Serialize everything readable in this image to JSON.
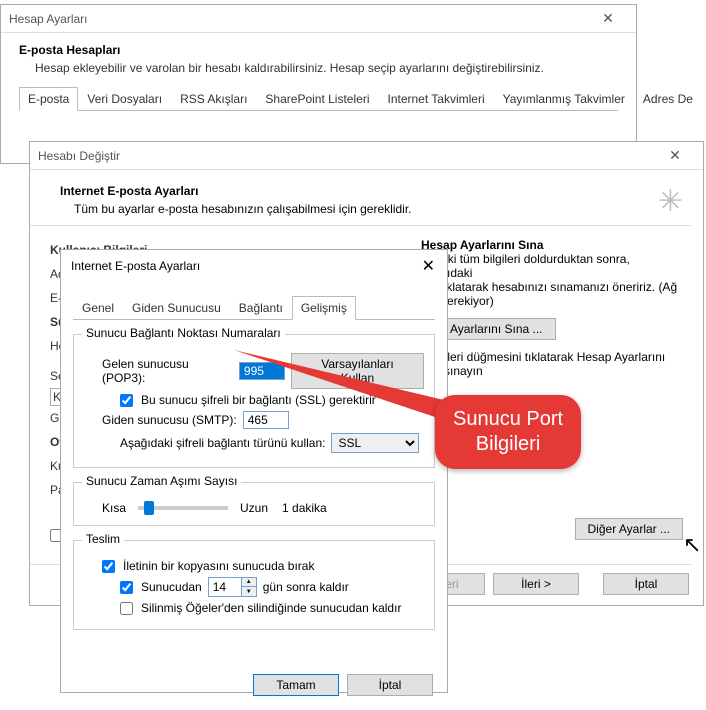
{
  "win1": {
    "title": "Hesap Ayarları",
    "heading": "E-posta Hesapları",
    "desc": "Hesap ekleyebilir ve varolan bir hesabı kaldırabilirsiniz. Hesap seçip ayarlarını değiştirebilirsiniz.",
    "tabs": [
      "E-posta",
      "Veri Dosyaları",
      "RSS Akışları",
      "SharePoint Listeleri",
      "Internet Takvimleri",
      "Yayımlanmış Takvimler",
      "Adres De"
    ]
  },
  "win2": {
    "title": "Hesabı Değiştir",
    "heading": "Internet E-posta Ayarları",
    "desc": "Tüm bu ayarlar e-posta hesabınızın çalışabilmesi için gereklidir.",
    "left_labels": {
      "user_info": "Kullanıcı Bilgileri",
      "ad": "Ad",
      "ep": "E-p",
      "su": "Su",
      "he": "He",
      "gi": "Gi",
      "ot": "Ot",
      "ku": "Ku",
      "pa": "Pa",
      "seg": "Seç",
      "k": "K"
    },
    "right": {
      "test_heading": "Hesap Ayarlarını Sına",
      "test_desc1": "andaki tüm bilgileri doldurduktan sonra, aşağıdaki",
      "test_desc2": "eyi tıklatarak hesabınızı sınamanızı öneririz. (Ağ",
      "test_desc3": "tısı gerekiyor)",
      "test_btn": "ap Ayarlarını Sına ...",
      "test_check": "İleri düğmesini tıklatarak Hesap Ayarlarını sınayın",
      "more_btn": "Diğer Ayarlar ..."
    },
    "footer": {
      "back": "< Geri",
      "next": "İleri >",
      "cancel": "İptal"
    }
  },
  "win3": {
    "title": "Internet E-posta Ayarları",
    "tabs": [
      "Genel",
      "Giden Sunucusu",
      "Bağlantı",
      "Gelişmiş"
    ],
    "group_ports": "Sunucu Bağlantı Noktası Numaraları",
    "pop_label": "Gelen sunucusu (POP3):",
    "pop_value": "995",
    "defaults_btn": "Varsayılanları Kullan",
    "ssl_pop": "Bu sunucu şifreli bir bağlantı (SSL) gerektirir",
    "smtp_label": "Giden sunucusu (SMTP):",
    "smtp_value": "465",
    "enc_label": "Aşağıdaki şifreli bağlantı türünü kullan:",
    "enc_value": "SSL",
    "group_timeout": "Sunucu Zaman Aşımı Sayısı",
    "short": "Kısa",
    "long": "Uzun",
    "timeout_val": "1 dakika",
    "group_teslim": "Teslim",
    "leave_copy": "İletinin bir kopyasını sunucuda bırak",
    "remove_after": "Sunucudan",
    "remove_after_days": "14",
    "remove_after_suffix": "gün sonra kaldır",
    "remove_on_delete": "Silinmiş Öğeler'den silindiğinde sunucudan kaldır",
    "ok": "Tamam",
    "cancel": "İptal"
  },
  "callout": "Sunucu Port\nBilgileri"
}
